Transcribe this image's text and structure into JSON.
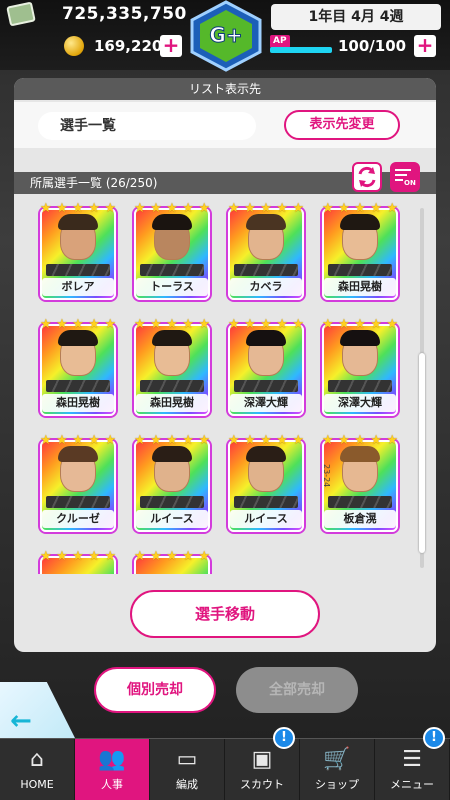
{
  "header": {
    "money": "725,335,750",
    "coins": "169,220",
    "date": "1年目 4月 4週",
    "ap_label": "AP",
    "ap_value": "100/100",
    "ap_fill": 1.0
  },
  "panel": {
    "list_dest_header": "リスト表示先",
    "list_dest_value": "選手一覧",
    "change_dest_button": "表示先変更",
    "roster_header": "所属選手一覧 (26/250)",
    "filter_badge": "ON",
    "move_button": "選手移動"
  },
  "players": [
    {
      "name": "ボレア",
      "stars": 5,
      "hair": "#3a2a1c",
      "skin": "#d9a27a"
    },
    {
      "name": "トーラス",
      "stars": 5,
      "hair": "#1a1410",
      "skin": "#b9865f"
    },
    {
      "name": "カベラ",
      "stars": 5,
      "hair": "#4a3422",
      "skin": "#e2b48e"
    },
    {
      "name": "森田晃樹",
      "stars": 5,
      "hair": "#1f1812",
      "skin": "#e8bc95"
    },
    {
      "name": "森田晃樹",
      "stars": 5,
      "hair": "#1f1812",
      "skin": "#e8bc95"
    },
    {
      "name": "森田晃樹",
      "stars": 5,
      "hair": "#1f1812",
      "skin": "#e8bc95"
    },
    {
      "name": "深澤大輝",
      "stars": 5,
      "hair": "#151010",
      "skin": "#e5b894"
    },
    {
      "name": "深澤大輝",
      "stars": 5,
      "hair": "#151010",
      "skin": "#e5b894"
    },
    {
      "name": "クルーゼ",
      "stars": 5,
      "hair": "#5a3a24",
      "skin": "#e6b996"
    },
    {
      "name": "ルイース",
      "stars": 5,
      "hair": "#2a1e16",
      "skin": "#e0b28c"
    },
    {
      "name": "ルイース",
      "stars": 5,
      "hair": "#2a1e16",
      "skin": "#e0b28c"
    },
    {
      "name": "板倉滉",
      "stars": 5,
      "hair": "#8a5a2c",
      "skin": "#e6b892",
      "season": "23-24"
    }
  ],
  "actions": {
    "sell_single": "個別売却",
    "sell_all": "全部売却"
  },
  "nav": [
    {
      "label": "HOME",
      "icon": "home-icon",
      "glyph": "⌂",
      "active": false,
      "notify": false
    },
    {
      "label": "人事",
      "icon": "people-icon",
      "glyph": "👥",
      "active": true,
      "notify": false
    },
    {
      "label": "編成",
      "icon": "pitch-icon",
      "glyph": "▭",
      "active": false,
      "notify": false
    },
    {
      "label": "スカウト",
      "icon": "id-card-icon",
      "glyph": "▣",
      "active": false,
      "notify": true
    },
    {
      "label": "ショップ",
      "icon": "cart-icon",
      "glyph": "🛒",
      "active": false,
      "notify": false
    },
    {
      "label": "メニュー",
      "icon": "menu-icon",
      "glyph": "☰",
      "active": false,
      "notify": true
    }
  ],
  "notify_mark": "!",
  "colors": {
    "accent": "#e0157f",
    "ap_bar": "#1ed4f2",
    "notify": "#1b89e8"
  }
}
